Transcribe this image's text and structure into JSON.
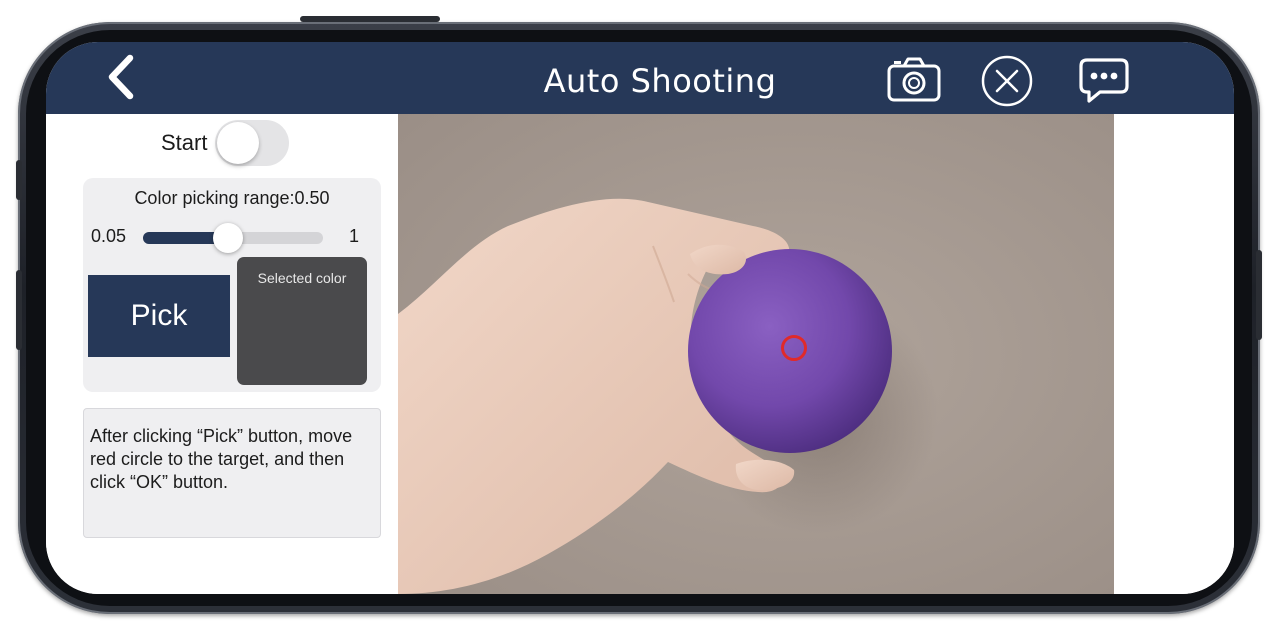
{
  "header": {
    "title": "Auto Shooting",
    "background_color": "#263858",
    "icons": {
      "back": "chevron-left-icon",
      "camera": "camera-icon",
      "close": "close-circle-icon",
      "chat": "chat-bubble-icon"
    }
  },
  "controls": {
    "start_label": "Start",
    "start_enabled": false,
    "range_title": "Color picking range:0.50",
    "slider_min_label": "0.05",
    "slider_max_label": "1",
    "slider_value_fraction": 0.47,
    "pick_label": "Pick",
    "selected_color_label": "Selected color",
    "selected_color_value": "#4a4a4c",
    "accent_color": "#263858"
  },
  "help": {
    "text": "After clicking “Pick” button, move red circle to the target, and then click “OK” button."
  },
  "camera": {
    "subject": "hand holding purple ball",
    "target_marker_color": "#e02a2a",
    "ball_color": "#7a4fb0",
    "background_color": "#a69a92"
  }
}
